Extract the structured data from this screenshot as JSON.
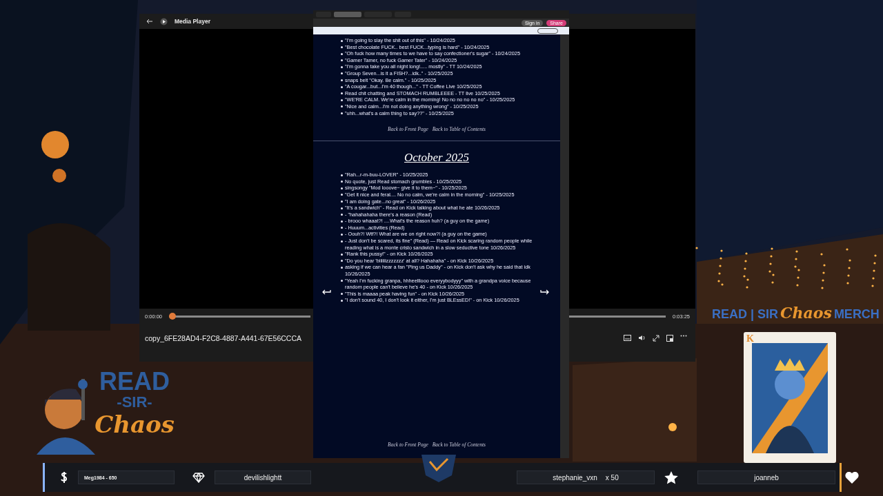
{
  "media_player": {
    "title": "Media Player",
    "elapsed": "0:00:00",
    "duration": "0:03:25",
    "level": 0,
    "file_name": "copy_6FE28AD4-F2C8-4887-A441-67E56CCCA"
  },
  "browser": {
    "tabs": [
      {
        "selected": false
      },
      {
        "selected": true
      },
      {
        "selected": false
      },
      {
        "selected": false
      }
    ],
    "toolbar_buttons": [
      {
        "kind": "plain",
        "label": "Sign in"
      },
      {
        "kind": "share",
        "label": "Share"
      }
    ],
    "sections": [
      {
        "items": [
          "\"I'm going to slay the shit out of this\" - 10/24/2025",
          "\"Best chocolate FUCK.. best FUCK...typing is hard\" - 10/24/2025",
          "\"Oh fuck how many times to we have to say confectioner's sugar\" - 10/24/2025",
          "\"Gamer Tamer, no fuck Gamer Tater\" - 10/24/2025",
          "\"I'm gonna take you all night long!..... mostly\" - TT 10/24/2025",
          "\"Group Seven...is it a FISH?...idk..\" - 10/25/2025",
          "snaps belt \"Okay. Be calm.\" - 10/25/2025",
          "\"A cougar...but...I'm 40 though...\" - TT Coffee Live 10/25/2025",
          "Read chit chatting and STOMACH RUMBLEEEE - TT live 10/25/2025",
          "\"WE'RE CALM. We're calm in the morning! No no no no no no\" - 10/25/2025",
          "\"Nice and calm...I'm not doing anything wrong\" - 10/25/2025",
          "\"uhh...what's a calm thing to say??\" - 10/25/2025"
        ],
        "links": [
          "Back to Front Page",
          "Back to Table of Contents"
        ]
      },
      {
        "heading": "October 2025",
        "items": [
          "\"Rah...r-m-buu-LOVER\" - 10/25/2025",
          "No quote, just Read stomach grumbles - 10/25/2025",
          "singsongy \"Mod looove~ give it to them~\" - 10/25/2025",
          "\"Get it nice and feral.... No no calm, we're calm in the morning\" - 10/25/2025",
          "\"I am doing gate...no great\" - 10/26/2025",
          "\"It's a sandwich\" - Read on Kick talking about what he ate 10/26/2025",
          "- \"hahahahaha there's a reason (Read)",
          "- brooo whaaat?! ....What's the reason huh? (a guy on the game)",
          "- Huuum...activities (Read)",
          "- Oouh?! Wtf?! What are we on right now?! (a guy on the game)",
          "- Just don't be scared, its fine\" (Read) — Read on Kick scaring random people while reading what is a monte cristo sandwich in a slow seductive tone 10/26/2025",
          "\"Rank this pussy!\" - on Kick 10/26/2025",
          "\"Do you hear 'biiiiiizzzzzzz' at all? Hahahaha\" - on Kick 10/26/2025",
          "asking if we can hear a fan \"Ping us Daddy\" - on Kick don't ask why he said that idk 10/26/2025",
          "\"Yeah I'm fucking granpa, hhheelllooo everyybodyyy\" with a grandpa voice because random people can't believe he's 40 - on Kick 10/26/2025",
          "\"This is maaaa peak having fun\" - on Kick 10/26/2025",
          "\"I don't sound 40, I don't look it either, I'm just BLEssED!\" - on Kick 10/26/2025"
        ],
        "links": [
          "Back to Front Page",
          "Back to Table of Contents"
        ]
      }
    ]
  },
  "overlay": {
    "logo": {
      "line_1": "READ",
      "line_2": "-SIR-",
      "line_3": "Chaos"
    },
    "merch_banner": {
      "lead": "READ | SIR",
      "script": "Chaos",
      "tail": "MERCH"
    },
    "card": {
      "rank": "K"
    },
    "alerts": [
      {
        "kind": "tip",
        "label": "Meg1984 - 650"
      },
      {
        "kind": "gem",
        "label": "devilishlightt"
      },
      {
        "kind": "gift",
        "label": "stephanie_vxn",
        "count": "x 50"
      },
      {
        "kind": "follow",
        "label": "joanneb"
      }
    ]
  }
}
